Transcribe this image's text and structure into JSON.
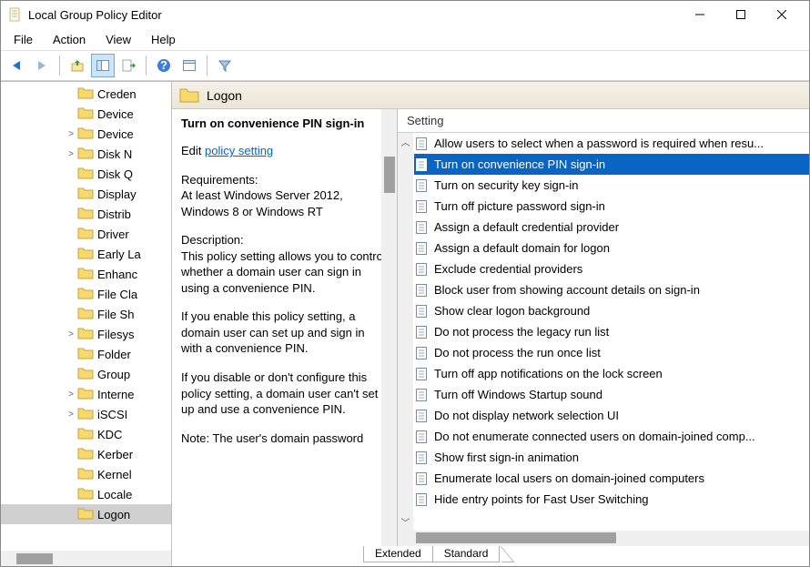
{
  "window": {
    "title": "Local Group Policy Editor"
  },
  "menu": {
    "file": "File",
    "action": "Action",
    "view": "View",
    "help": "Help"
  },
  "tree": {
    "items": [
      {
        "exp": "",
        "label": "Creden",
        "sel": false
      },
      {
        "exp": "",
        "label": "Device",
        "sel": false
      },
      {
        "exp": ">",
        "label": "Device",
        "sel": false
      },
      {
        "exp": ">",
        "label": "Disk N",
        "sel": false
      },
      {
        "exp": "",
        "label": "Disk Q",
        "sel": false
      },
      {
        "exp": "",
        "label": "Display",
        "sel": false
      },
      {
        "exp": "",
        "label": "Distrib",
        "sel": false
      },
      {
        "exp": "",
        "label": "Driver",
        "sel": false
      },
      {
        "exp": "",
        "label": "Early La",
        "sel": false
      },
      {
        "exp": "",
        "label": "Enhanc",
        "sel": false
      },
      {
        "exp": "",
        "label": "File Cla",
        "sel": false
      },
      {
        "exp": "",
        "label": "File Sh",
        "sel": false
      },
      {
        "exp": ">",
        "label": "Filesys",
        "sel": false
      },
      {
        "exp": "",
        "label": "Folder",
        "sel": false
      },
      {
        "exp": "",
        "label": "Group",
        "sel": false
      },
      {
        "exp": ">",
        "label": "Interne",
        "sel": false
      },
      {
        "exp": ">",
        "label": "iSCSI",
        "sel": false
      },
      {
        "exp": "",
        "label": "KDC",
        "sel": false
      },
      {
        "exp": "",
        "label": "Kerber",
        "sel": false
      },
      {
        "exp": "",
        "label": "Kernel",
        "sel": false
      },
      {
        "exp": "",
        "label": "Locale",
        "sel": false
      },
      {
        "exp": "",
        "label": "Logon",
        "sel": true
      }
    ]
  },
  "header": {
    "title": "Logon"
  },
  "detail": {
    "selected_title": "Turn on convenience PIN sign-in",
    "edit_prefix": "Edit ",
    "edit_link": "policy setting",
    "req_label": "Requirements:",
    "req_text": "At least Windows Server 2012, Windows 8 or Windows RT",
    "desc_label": "Description:",
    "desc_p1": "This policy setting allows you to control whether a domain user can sign in using a convenience PIN.",
    "desc_p2": "If you enable this policy setting, a domain user can set up and sign in with a convenience PIN.",
    "desc_p3": "If you disable or don't configure this policy setting, a domain user can't set up and use a convenience PIN.",
    "desc_p4": "Note: The user's domain password"
  },
  "list": {
    "column": "Setting",
    "items": [
      {
        "label": "Allow users to select when a password is required when resu...",
        "sel": false
      },
      {
        "label": "Turn on convenience PIN sign-in",
        "sel": true
      },
      {
        "label": "Turn on security key sign-in",
        "sel": false
      },
      {
        "label": "Turn off picture password sign-in",
        "sel": false
      },
      {
        "label": "Assign a default credential provider",
        "sel": false
      },
      {
        "label": "Assign a default domain for logon",
        "sel": false
      },
      {
        "label": "Exclude credential providers",
        "sel": false
      },
      {
        "label": "Block user from showing account details on sign-in",
        "sel": false
      },
      {
        "label": "Show clear logon background",
        "sel": false
      },
      {
        "label": "Do not process the legacy run list",
        "sel": false
      },
      {
        "label": "Do not process the run once list",
        "sel": false
      },
      {
        "label": "Turn off app notifications on the lock screen",
        "sel": false
      },
      {
        "label": "Turn off Windows Startup sound",
        "sel": false
      },
      {
        "label": "Do not display network selection UI",
        "sel": false
      },
      {
        "label": "Do not enumerate connected users on domain-joined comp...",
        "sel": false
      },
      {
        "label": "Show first sign-in animation",
        "sel": false
      },
      {
        "label": "Enumerate local users on domain-joined computers",
        "sel": false
      },
      {
        "label": "Hide entry points for Fast User Switching",
        "sel": false
      }
    ]
  },
  "tabs": {
    "extended": "Extended",
    "standard": "Standard"
  }
}
